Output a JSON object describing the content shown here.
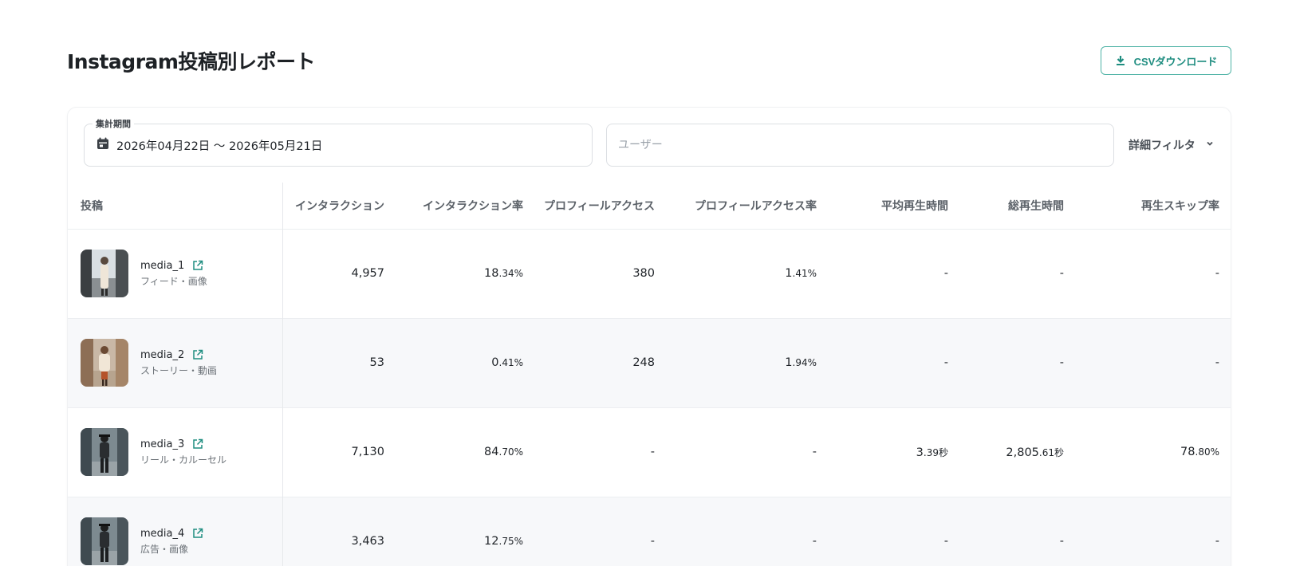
{
  "header": {
    "title": "Instagram投稿別レポート",
    "csv_button_label": "CSVダウンロード"
  },
  "filters": {
    "period_label": "集計期間",
    "period_value": "2026年04月22日 〜 2026年05月21日",
    "user_placeholder": "ユーザー",
    "advanced_filter_label": "詳細フィルタ"
  },
  "table": {
    "columns": [
      "投稿",
      "インタラクション",
      "インタラクション率",
      "プロフィールアクセス",
      "プロフィールアクセス率",
      "平均再生時間",
      "総再生時間",
      "再生スキップ率"
    ],
    "rows": [
      {
        "name": "media_1",
        "type": "フィード・画像",
        "interactions": "4,957",
        "interaction_rate_int": "18",
        "interaction_rate_dec": ".34%",
        "profile_access": "380",
        "profile_rate_int": "1",
        "profile_rate_dec": ".41%",
        "avg_play_int": "-",
        "avg_play_dec": "",
        "total_play_int": "-",
        "total_play_dec": "",
        "skip_rate_int": "-",
        "skip_rate_dec": ""
      },
      {
        "name": "media_2",
        "type": "ストーリー・動画",
        "interactions": "53",
        "interaction_rate_int": "0",
        "interaction_rate_dec": ".41%",
        "profile_access": "248",
        "profile_rate_int": "1",
        "profile_rate_dec": ".94%",
        "avg_play_int": "-",
        "avg_play_dec": "",
        "total_play_int": "-",
        "total_play_dec": "",
        "skip_rate_int": "-",
        "skip_rate_dec": ""
      },
      {
        "name": "media_3",
        "type": "リール・カルーセル",
        "interactions": "7,130",
        "interaction_rate_int": "84",
        "interaction_rate_dec": ".70%",
        "profile_access": "-",
        "profile_rate_int": "-",
        "profile_rate_dec": "",
        "avg_play_int": "3",
        "avg_play_dec": ".39秒",
        "total_play_int": "2,805",
        "total_play_dec": ".61秒",
        "skip_rate_int": "78",
        "skip_rate_dec": ".80%"
      },
      {
        "name": "media_4",
        "type": "広告・画像",
        "interactions": "3,463",
        "interaction_rate_int": "12",
        "interaction_rate_dec": ".75%",
        "profile_access": "-",
        "profile_rate_int": "-",
        "profile_rate_dec": "",
        "avg_play_int": "-",
        "avg_play_dec": "",
        "total_play_int": "-",
        "total_play_dec": "",
        "skip_rate_int": "-",
        "skip_rate_dec": ""
      }
    ]
  },
  "colors": {
    "accent": "#1f8d80",
    "accent_border": "#4fb3a6",
    "row_shade": "#f7f8fa"
  },
  "icons": {
    "download": "download-icon",
    "calendar": "calendar-icon",
    "chevron": "chevron-down-icon",
    "external_link": "external-link-icon"
  }
}
